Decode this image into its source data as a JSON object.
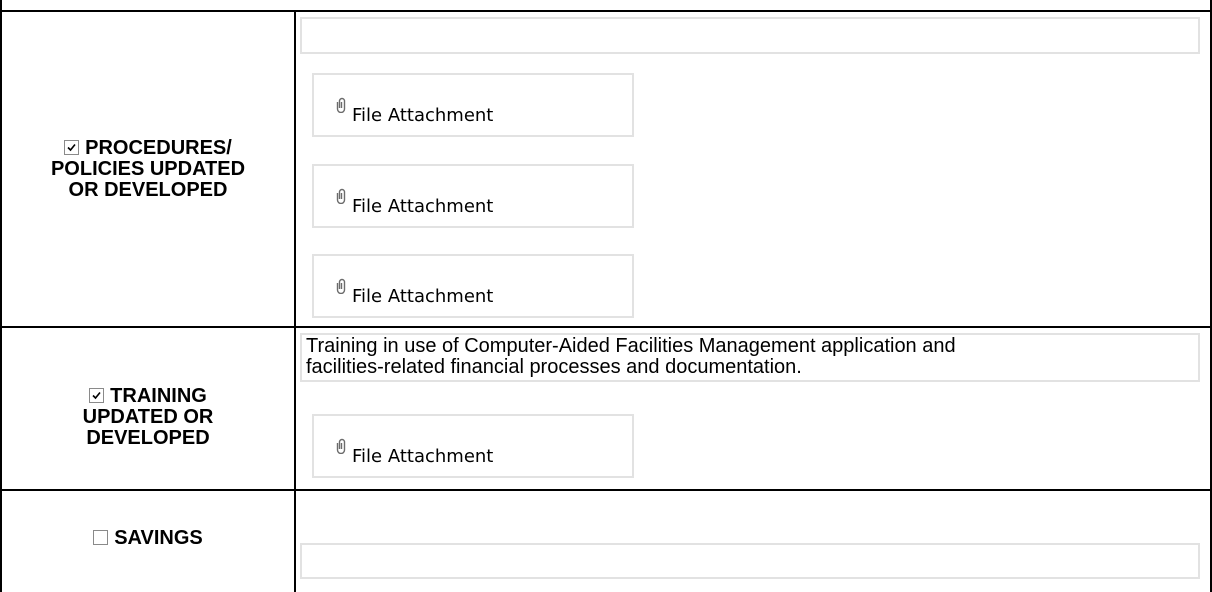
{
  "rows": [
    {
      "checked": true,
      "label_lines": [
        "PROCEDURES/",
        "POLICIES UPDATED",
        "OR DEVELOPED"
      ],
      "text": "",
      "attachments": [
        "File Attachment",
        "File Attachment",
        "File Attachment"
      ]
    },
    {
      "checked": true,
      "label_lines": [
        "TRAINING",
        "UPDATED OR",
        "DEVELOPED"
      ],
      "text_lines": [
        "Training in use of Computer-Aided Facilities Management application and",
        "facilities-related financial processes and documentation."
      ],
      "attachments": [
        "File Attachment"
      ]
    },
    {
      "checked": false,
      "label_lines": [
        "SAVINGS"
      ],
      "text": "",
      "attachments": []
    }
  ],
  "icons": {
    "checkbox": "checkbox-icon",
    "attachment": "paperclip-icon"
  },
  "colors": {
    "grid": "#000000",
    "field_border": "#e2e2e2",
    "checkbox_border": "#8a8a8a"
  }
}
